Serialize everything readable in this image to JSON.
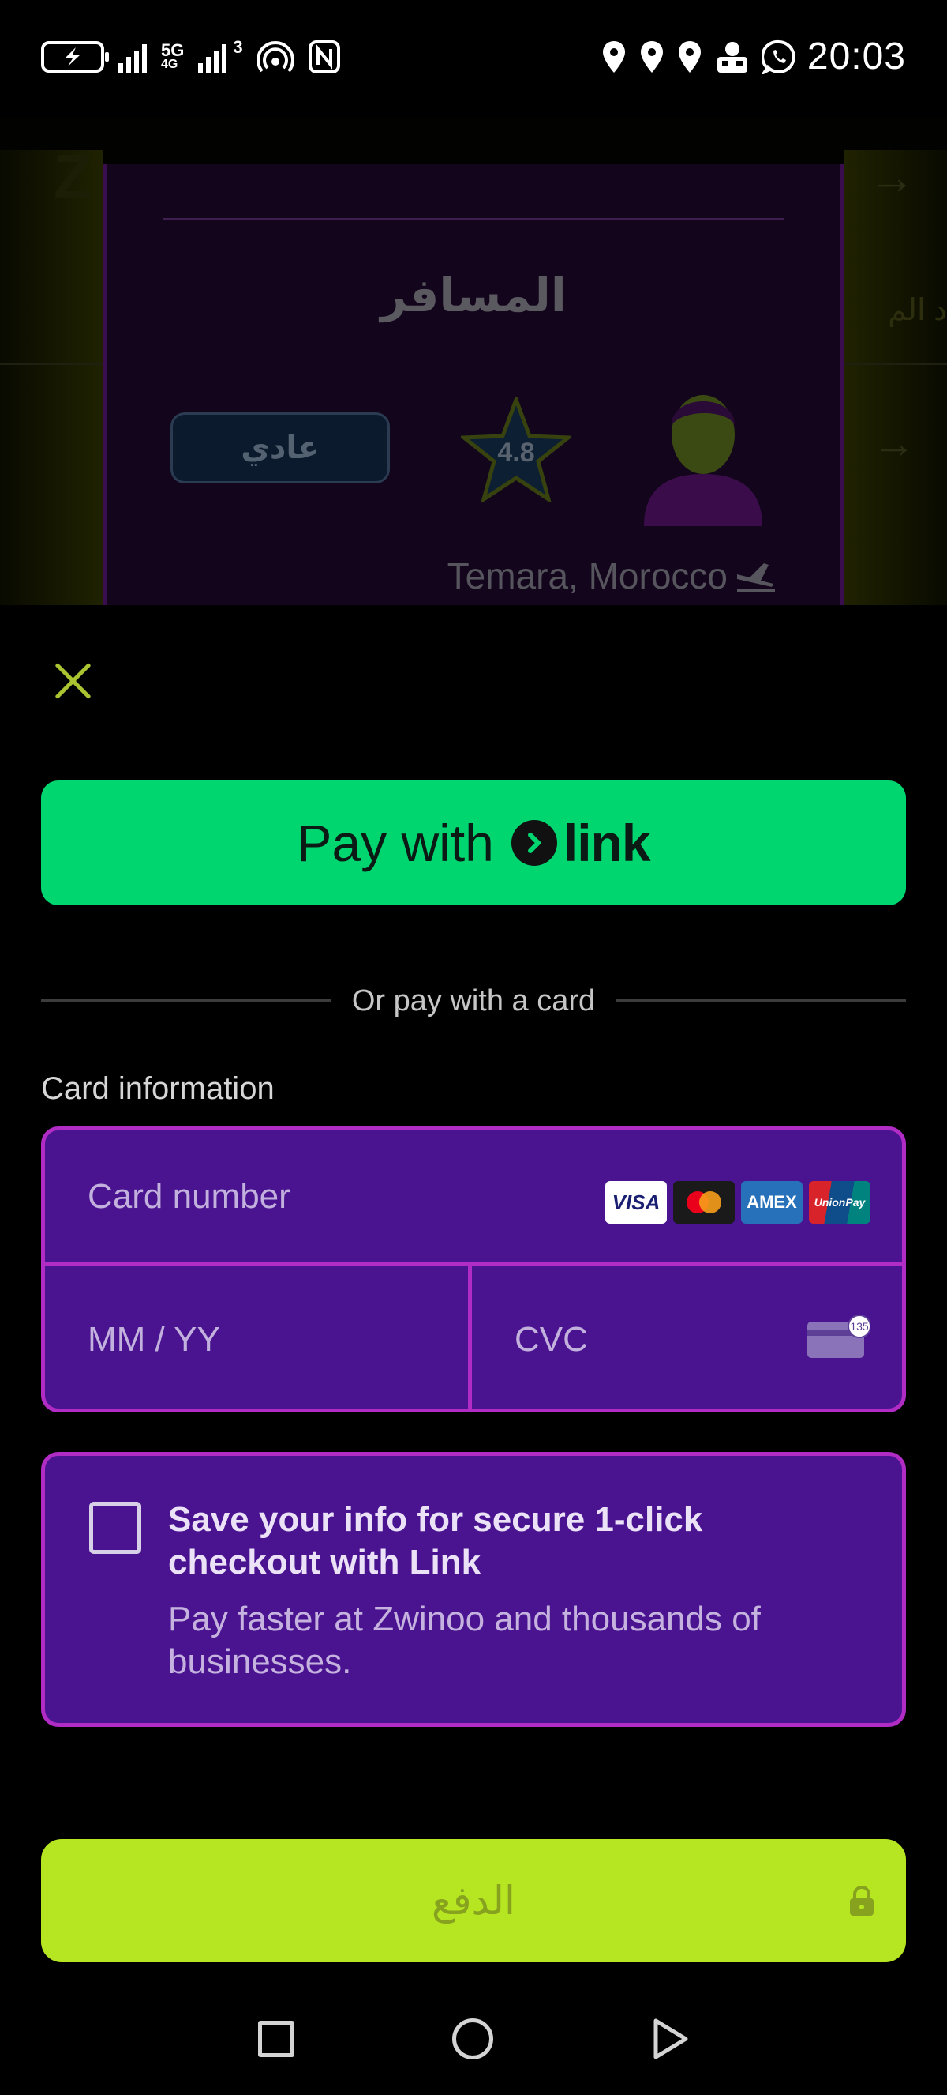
{
  "status_bar": {
    "network_type": "5G",
    "network_sub": "4G",
    "sim2_label": "3",
    "time": "20:03"
  },
  "background_page": {
    "logo_fragment": "Z",
    "side_text_fragment": "د الم",
    "passenger_title": "المسافر",
    "category_pill": "عادي",
    "rating": "4.8",
    "location": "Temara, Morocco"
  },
  "sheet": {
    "link_button": {
      "prefix": "Pay with",
      "brand": "link"
    },
    "divider_text": "Or pay with a card",
    "card_info_label": "Card information",
    "card_number_placeholder": "Card number",
    "expiry_placeholder": "MM / YY",
    "cvc_placeholder": "CVC",
    "card_brands": [
      "VISA",
      "mastercard-icon",
      "AMEX",
      "UnionPay"
    ],
    "save_info": {
      "title": "Save your info for secure 1-click checkout with Link",
      "subtitle": "Pay faster at Zwinoo and thousands of businesses.",
      "checked": false
    },
    "pay_button_label": "الدفع"
  },
  "colors": {
    "link_green": "#00d66f",
    "card_purple": "#4a1491",
    "card_border": "#b02cc4",
    "pay_lime": "#b6e521",
    "close_x": "#a9c430"
  }
}
